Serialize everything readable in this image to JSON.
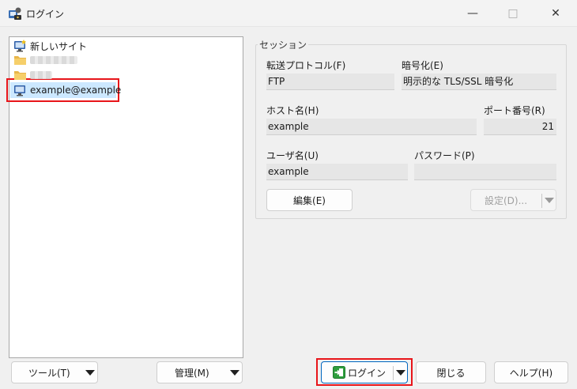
{
  "window": {
    "title": "ログイン",
    "min_glyph": "—",
    "max_glyph": "□",
    "close_glyph": "✕",
    "icons": [
      "winscp-app-icon"
    ]
  },
  "site_tree": {
    "items": [
      {
        "label": "新しいサイト",
        "icon": "new-site-monitor-icon"
      },
      {
        "label": "",
        "icon": "folder-icon",
        "blurred": true
      },
      {
        "label": "",
        "icon": "folder-icon",
        "blurred": true
      },
      {
        "label": "example@example",
        "icon": "monitor-icon",
        "selected": true
      }
    ]
  },
  "session": {
    "legend": "セッション",
    "protocol_label": "転送プロトコル(F)",
    "protocol_value": "FTP",
    "encryption_label": "暗号化(E)",
    "encryption_value": "明示的な TLS/SSL 暗号化",
    "host_label": "ホスト名(H)",
    "host_value": "example",
    "port_label": "ポート番号(R)",
    "port_value": "21",
    "user_label": "ユーザ名(U)",
    "user_value": "example",
    "password_label": "パスワード(P)",
    "password_value": "",
    "edit_button": "編集(E)",
    "settings_button": "設定(D)..."
  },
  "bottom": {
    "tools_button": "ツール(T)",
    "manage_button": "管理(M)",
    "login_button": "ログイン",
    "close_button": "閉じる",
    "help_button": "ヘルプ(H)"
  },
  "colors": {
    "highlight_red": "#e8151a",
    "selection_blue": "#cce8ff",
    "primary_border": "#0067c0",
    "login_icon_green": "#2e9e3e"
  }
}
